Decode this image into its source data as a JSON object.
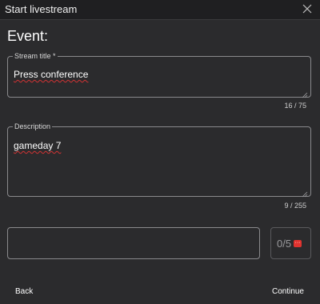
{
  "window": {
    "title": "Start livestream",
    "close_icon": "close-icon"
  },
  "heading": "Event:",
  "stream_title": {
    "label": "Stream title *",
    "value": "Press conference",
    "counter": "16 / 75"
  },
  "description": {
    "label": "Description",
    "value": "gameday 7",
    "counter": "9 / 255"
  },
  "extra_input": {
    "value": ""
  },
  "tag_box": {
    "count": "0/5",
    "badge": "···",
    "badge_color": "#e0332f"
  },
  "footer": {
    "back_label": "Back",
    "continue_label": "Continue"
  }
}
